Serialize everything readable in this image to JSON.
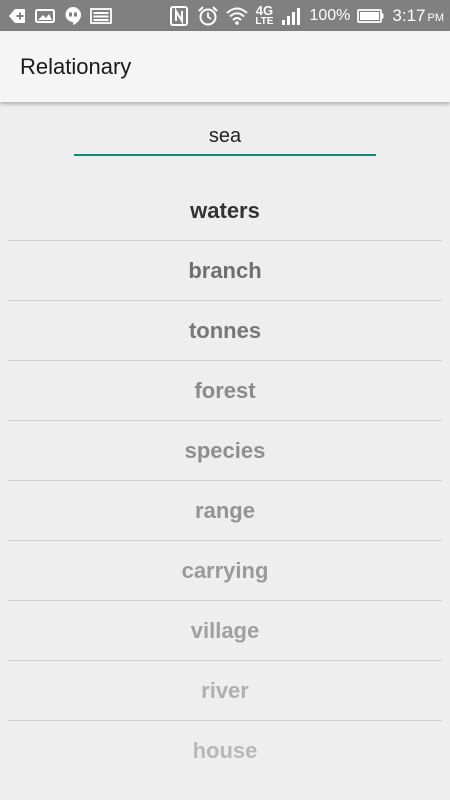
{
  "status_bar": {
    "battery_percent": "100%",
    "time": "3:17",
    "ampm": "PM",
    "network_label": "4G",
    "network_sub": "LTE",
    "icons": [
      "plus-box-icon",
      "image-icon",
      "hangouts-icon",
      "keyboard-icon",
      "nfc-icon",
      "alarm-icon",
      "wifi-icon",
      "signal-icon",
      "battery-icon"
    ]
  },
  "app_bar": {
    "title": "Relationary"
  },
  "search": {
    "value": "sea",
    "accent_color": "#12897a"
  },
  "results": [
    {
      "word": "waters",
      "color": "#333333"
    },
    {
      "word": "branch",
      "color": "#6f6f6f"
    },
    {
      "word": "tonnes",
      "color": "#777777"
    },
    {
      "word": "forest",
      "color": "#8a8a8a"
    },
    {
      "word": "species",
      "color": "#8e8e8e"
    },
    {
      "word": "range",
      "color": "#939393"
    },
    {
      "word": "carrying",
      "color": "#9a9a9a"
    },
    {
      "word": "village",
      "color": "#a0a0a0"
    },
    {
      "word": "river",
      "color": "#b0b0b0"
    },
    {
      "word": "house",
      "color": "#b8b8b8"
    }
  ]
}
